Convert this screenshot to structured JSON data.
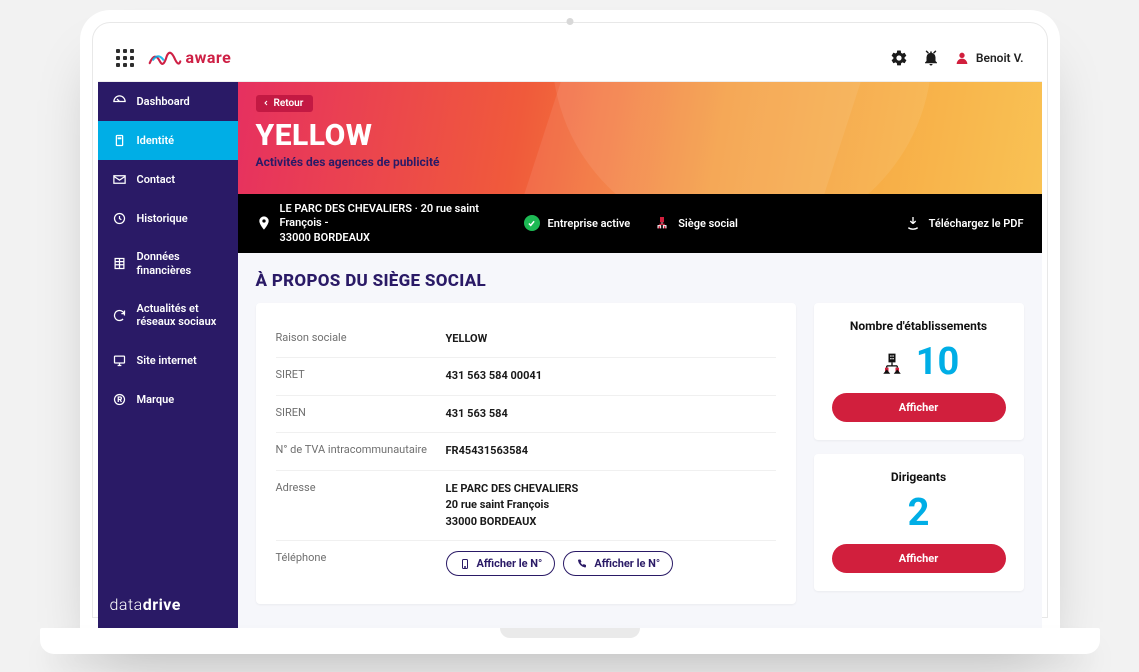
{
  "brand": {
    "name": "aware"
  },
  "user": {
    "name": "Benoit V."
  },
  "sidebar": {
    "items": [
      {
        "label": "Dashboard"
      },
      {
        "label": "Identité"
      },
      {
        "label": "Contact"
      },
      {
        "label": "Historique"
      },
      {
        "label": "Données financières"
      },
      {
        "label": "Actualités et réseaux sociaux"
      },
      {
        "label": "Site internet"
      },
      {
        "label": "Marque"
      }
    ],
    "powered": "datadrive"
  },
  "hero": {
    "back": "Retour",
    "title": "YELLOW",
    "subtitle": "Activités des agences de publicité"
  },
  "infobar": {
    "address_l1": "LE PARC DES CHEVALIERS   ·   20 rue saint François -",
    "address_l2": "33000 BORDEAUX",
    "status": "Entreprise active",
    "siege": "Siège social",
    "download": "Téléchargez le PDF"
  },
  "section": {
    "title": "À PROPOS DU SIÈGE SOCIAL"
  },
  "details": {
    "rows": [
      {
        "k": "Raison sociale",
        "v": "YELLOW"
      },
      {
        "k": "SIRET",
        "v": "431 563 584 00041"
      },
      {
        "k": "SIREN",
        "v": "431 563 584"
      },
      {
        "k": "N° de TVA intracommunautaire",
        "v": "FR45431563584"
      }
    ],
    "address_k": "Adresse",
    "address_lines": [
      "LE PARC DES CHEVALIERS",
      "20 rue saint François",
      "33000 BORDEAUX"
    ],
    "phone_k": "Téléphone",
    "phone_btn": "Afficher le N°"
  },
  "cards": {
    "etab": {
      "title": "Nombre d'établissements",
      "value": "10",
      "cta": "Afficher"
    },
    "dirigeants": {
      "title": "Dirigeants",
      "value": "2",
      "cta": "Afficher"
    }
  }
}
